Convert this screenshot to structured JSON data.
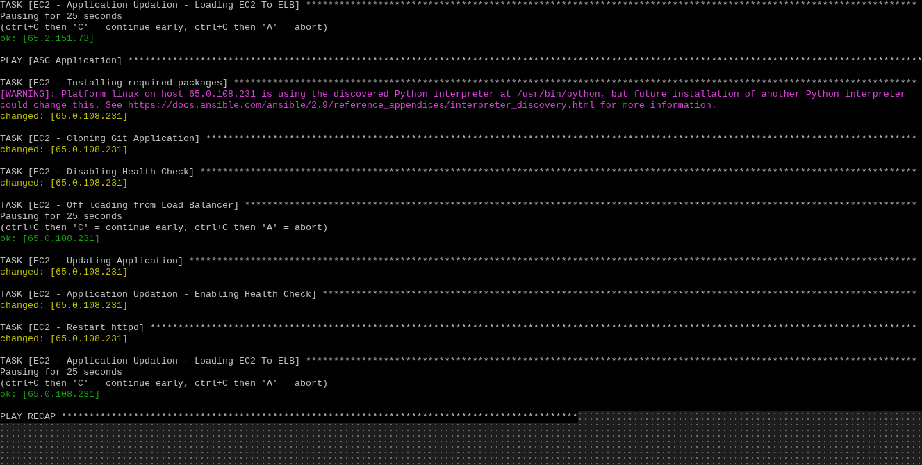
{
  "terminal": {
    "lines": [
      {
        "kind": "task",
        "text": "TASK [EC2 - Application Updation - Loading EC2 To ELB] **************************************************************************************************************"
      },
      {
        "kind": "text",
        "text": "Pausing for 25 seconds"
      },
      {
        "kind": "text",
        "text": "(ctrl+C then 'C' = continue early, ctrl+C then 'A' = abort)"
      },
      {
        "kind": "ok",
        "text": "ok: [65.2.151.73]"
      },
      {
        "kind": "blank"
      },
      {
        "kind": "play",
        "text": "PLAY [ASG Application] ***********************************************************************************************************************************************"
      },
      {
        "kind": "blank"
      },
      {
        "kind": "task",
        "text": "TASK [EC2 - Installing required packages] ***************************************************************************************************************************"
      },
      {
        "kind": "warning",
        "text": "[WARNING]: Platform linux on host 65.0.108.231 is using the discovered Python interpreter at /usr/bin/python, but future installation of another Python interpreter"
      },
      {
        "kind": "warning",
        "text": "could change this. See https://docs.ansible.com/ansible/2.9/reference_appendices/interpreter_discovery.html for more information."
      },
      {
        "kind": "changed",
        "text": "changed: [65.0.108.231]"
      },
      {
        "kind": "blank"
      },
      {
        "kind": "task",
        "text": "TASK [EC2 - Cloning Git Application] ********************************************************************************************************************************"
      },
      {
        "kind": "changed",
        "text": "changed: [65.0.108.231]"
      },
      {
        "kind": "blank"
      },
      {
        "kind": "task",
        "text": "TASK [EC2 - Disabling Health Check] *********************************************************************************************************************************"
      },
      {
        "kind": "changed",
        "text": "changed: [65.0.108.231]"
      },
      {
        "kind": "blank"
      },
      {
        "kind": "task",
        "text": "TASK [EC2 - Off loading from Load Balancer] *************************************************************************************************************************"
      },
      {
        "kind": "text",
        "text": "Pausing for 25 seconds"
      },
      {
        "kind": "text",
        "text": "(ctrl+C then 'C' = continue early, ctrl+C then 'A' = abort)"
      },
      {
        "kind": "ok",
        "text": "ok: [65.0.108.231]"
      },
      {
        "kind": "blank"
      },
      {
        "kind": "task",
        "text": "TASK [EC2 - Updating Application] ***********************************************************************************************************************************"
      },
      {
        "kind": "changed",
        "text": "changed: [65.0.108.231]"
      },
      {
        "kind": "blank"
      },
      {
        "kind": "task",
        "text": "TASK [EC2 - Application Updation - Enabling Health Check] ***********************************************************************************************************"
      },
      {
        "kind": "changed",
        "text": "changed: [65.0.108.231]"
      },
      {
        "kind": "blank"
      },
      {
        "kind": "task",
        "text": "TASK [EC2 - Restart httpd] ******************************************************************************************************************************************"
      },
      {
        "kind": "changed",
        "text": "changed: [65.0.108.231]"
      },
      {
        "kind": "blank"
      },
      {
        "kind": "task",
        "text": "TASK [EC2 - Application Updation - Loading EC2 To ELB] **************************************************************************************************************"
      },
      {
        "kind": "text",
        "text": "Pausing for 25 seconds"
      },
      {
        "kind": "text",
        "text": "(ctrl+C then 'C' = continue early, ctrl+C then 'A' = abort)"
      },
      {
        "kind": "ok",
        "text": "ok: [65.0.108.231]"
      },
      {
        "kind": "blank"
      },
      {
        "kind": "recap",
        "text": "PLAY RECAP *********************************************************************************************"
      }
    ]
  }
}
